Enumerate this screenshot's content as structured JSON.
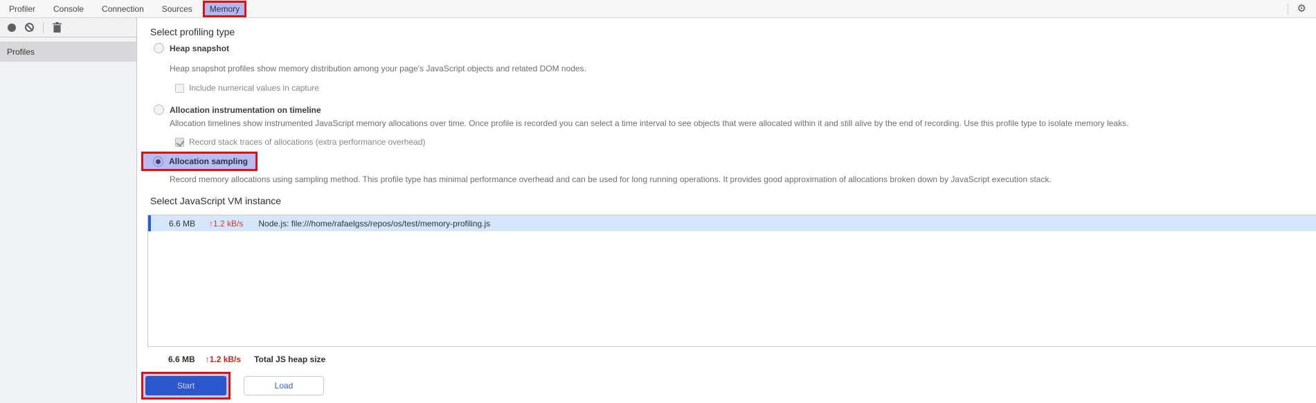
{
  "colors": {
    "annotation_red": "#e01111",
    "highlight_lavender": "#b5b7f3",
    "selected_row_blue": "#d5e6fa",
    "row_accent_blue": "#2d5fcc",
    "start_button_blue": "#2b57cb",
    "rate_red": "#d9372c"
  },
  "tabbar": {
    "tabs": [
      {
        "label": "Profiler"
      },
      {
        "label": "Console"
      },
      {
        "label": "Connection"
      },
      {
        "label": "Sources"
      },
      {
        "label": "Memory"
      }
    ],
    "active_tab": "Memory",
    "gear_icon": "⚙"
  },
  "toolbar": {
    "record_icon": "record",
    "clear_icon": "block",
    "trash_icon": "trash"
  },
  "sidebar": {
    "header": "Profiles"
  },
  "profiling": {
    "heading": "Select profiling type",
    "options": [
      {
        "label": "Heap snapshot",
        "selected": false,
        "description": "Heap snapshot profiles show memory distribution among your page's JavaScript objects and related DOM nodes.",
        "checkbox": {
          "label": "Include numerical values in capture",
          "checked": false
        }
      },
      {
        "label": "Allocation instrumentation on timeline",
        "selected": false,
        "description": "Allocation timelines show instrumented JavaScript memory allocations over time. Once profile is recorded you can select a time interval to see objects that were allocated within it and still alive by the end of recording. Use this profile type to isolate memory leaks.",
        "checkbox": {
          "label": "Record stack traces of allocations (extra performance overhead)",
          "checked": true
        }
      },
      {
        "label": "Allocation sampling",
        "selected": true,
        "highlighted": true,
        "description": "Record memory allocations using sampling method. This profile type has minimal performance overhead and can be used for long running operations. It provides good approximation of allocations broken down by JavaScript execution stack."
      }
    ]
  },
  "vm": {
    "heading": "Select JavaScript VM instance",
    "rows": [
      {
        "size": "6.6 MB",
        "rate": "↑1.2 kB/s",
        "name": "Node.js: file:///home/rafaelgss/repos/os/test/memory-profiling.js",
        "selected": true
      }
    ],
    "summary": {
      "size": "6.6 MB",
      "rate": "↑1.2 kB/s",
      "label": "Total JS heap size"
    }
  },
  "actions": {
    "start_label": "Start",
    "load_label": "Load"
  }
}
